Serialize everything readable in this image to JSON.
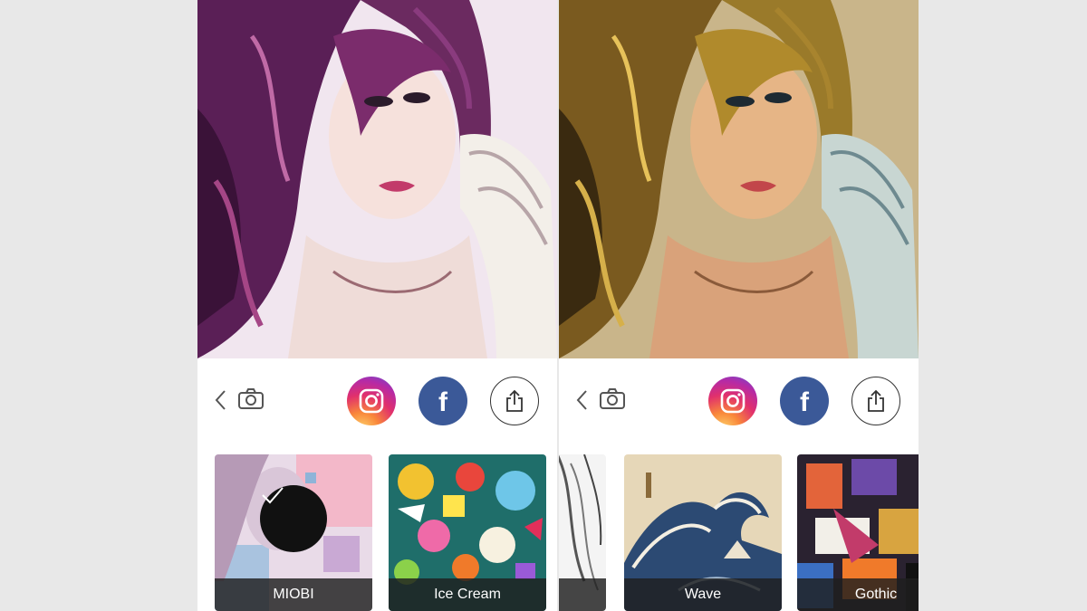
{
  "panels": [
    {
      "filters": [
        {
          "label": "MIOBI",
          "selected": true
        },
        {
          "label": "Ice Cream",
          "selected": false
        }
      ]
    },
    {
      "filters": [
        {
          "label": "",
          "selected": false
        },
        {
          "label": "Wave",
          "selected": false
        },
        {
          "label": "Gothic",
          "selected": false
        }
      ]
    }
  ],
  "icons": {
    "back": "chevron-left-icon",
    "camera": "camera-icon",
    "instagram": "instagram-icon",
    "facebook": "facebook-icon",
    "share": "share-icon",
    "selected": "checkmark-icon"
  },
  "facebook_glyph": "f",
  "colors": {
    "facebook": "#3b5998",
    "instagram_start": "#fdd870",
    "instagram_end": "#5b51d8",
    "label_bg": "#1e1e1e"
  }
}
